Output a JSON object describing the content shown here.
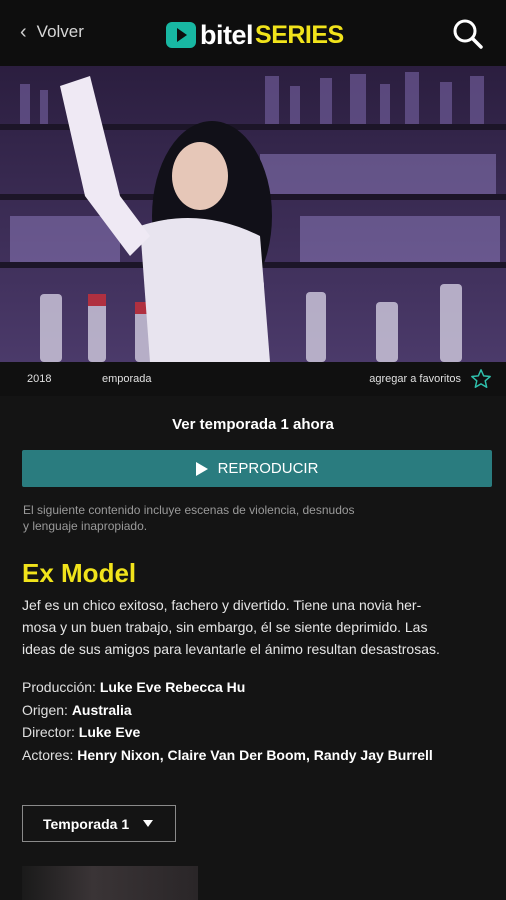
{
  "header": {
    "back_label": "Volver",
    "logo_bitel": "bitel",
    "logo_series": "SERIES"
  },
  "meta": {
    "year": "2018",
    "season": "emporada",
    "favorites_label": "agregar a favoritos"
  },
  "cta": {
    "watch_text": "Ver temporada 1 ahora",
    "play_label": "REPRODUCIR"
  },
  "warning_line1": "El siguiente contenido incluye escenas de violencia, desnudos",
  "warning_line2": "y lenguaje inapropiado.",
  "show": {
    "title": "Ex Model",
    "synopsis_line1": "Jef es un chico exitoso, fachero y divertido. Tiene una novia her-",
    "synopsis_line2": "mosa y un buen trabajo, sin embargo, él se siente deprimido. Las",
    "synopsis_line3": "ideas de sus amigos para levantarle el ánimo resultan desastrosas."
  },
  "credits": {
    "production_label": "Producción:",
    "production_value": "Luke Eve Rebecca Hu",
    "origin_label": "Origen:",
    "origin_value": "Australia",
    "director_label": "Director:",
    "director_value": "Luke Eve",
    "actors_label": "Actores:",
    "actors_value": "Henry Nixon, Claire Van Der Boom, Randy Jay Burrell"
  },
  "season_select": {
    "selected": "Temporada 1"
  },
  "colors": {
    "accent_yellow": "#f1e31b",
    "play_button": "#2a7c7f",
    "brand_teal": "#18b7a2",
    "background": "#141414"
  }
}
